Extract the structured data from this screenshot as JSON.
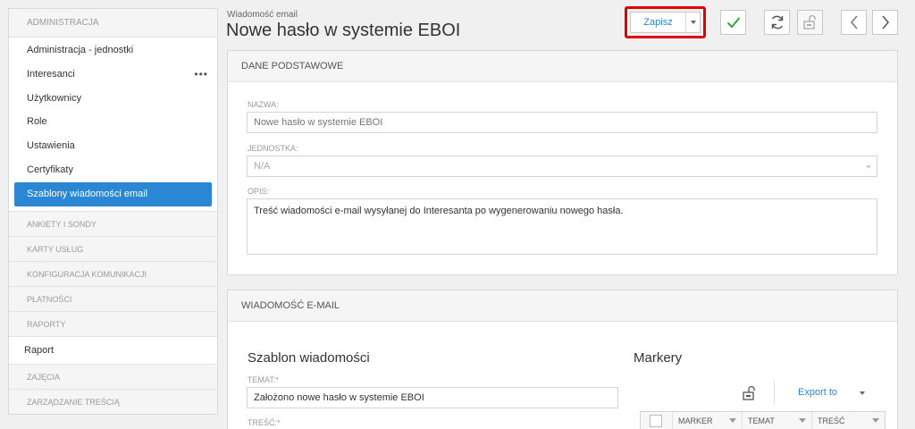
{
  "sidebar": {
    "header": "ADMINISTRACJA",
    "items": [
      {
        "label": "Administracja - jednostki"
      },
      {
        "label": "Interesanci",
        "more": "•••"
      },
      {
        "label": "Użytkownicy"
      },
      {
        "label": "Role"
      },
      {
        "label": "Ustawienia"
      },
      {
        "label": "Certyfikaty"
      },
      {
        "label": "Szablony wiadomości email",
        "active": true
      }
    ],
    "sections": [
      "ANKIETY I SONDY",
      "KARTY USŁUG",
      "KONFIGURACJA KOMUNIKACJI",
      "PŁATNOŚCI",
      "RAPORTY"
    ],
    "raport": "Raport",
    "sections2": [
      "ZAJĘCIA",
      "ZARZĄDZANIE TREŚCIĄ"
    ]
  },
  "header": {
    "subtitle": "Wiadomość email",
    "title": "Nowe hasło w systemie EBOI"
  },
  "toolbar": {
    "save_label": "Zapisz",
    "icons": [
      "check-icon",
      "refresh-icon",
      "unlock-icon",
      "chevron-left-icon",
      "chevron-right-icon"
    ]
  },
  "basic": {
    "heading": "DANE PODSTAWOWE",
    "name_label": "NAZWA:",
    "name_placeholder": "Nowe hasło w systemie EBOI",
    "unit_label": "JEDNOSTKA:",
    "unit_value": "N/A",
    "desc_label": "OPIS:",
    "desc_value": "Treść wiadomości e-mail wysyłanej do Interesanta po wygenerowaniu nowego hasła."
  },
  "email": {
    "heading": "WIADOMOŚĆ E-MAIL",
    "template_title": "Szablon wiadomości",
    "subject_label": "TEMAT:*",
    "subject_value": "Założono nowe hasło w systemie EBOI",
    "body_label": "TREŚĆ:*",
    "markers_title": "Markery",
    "export_label": "Export to",
    "columns": [
      "MARKER",
      "TEMAT",
      "TREŚĆ"
    ]
  },
  "colors": {
    "accent": "#2b86d4",
    "highlight": "#e00000",
    "check": "#2eaa3a"
  }
}
